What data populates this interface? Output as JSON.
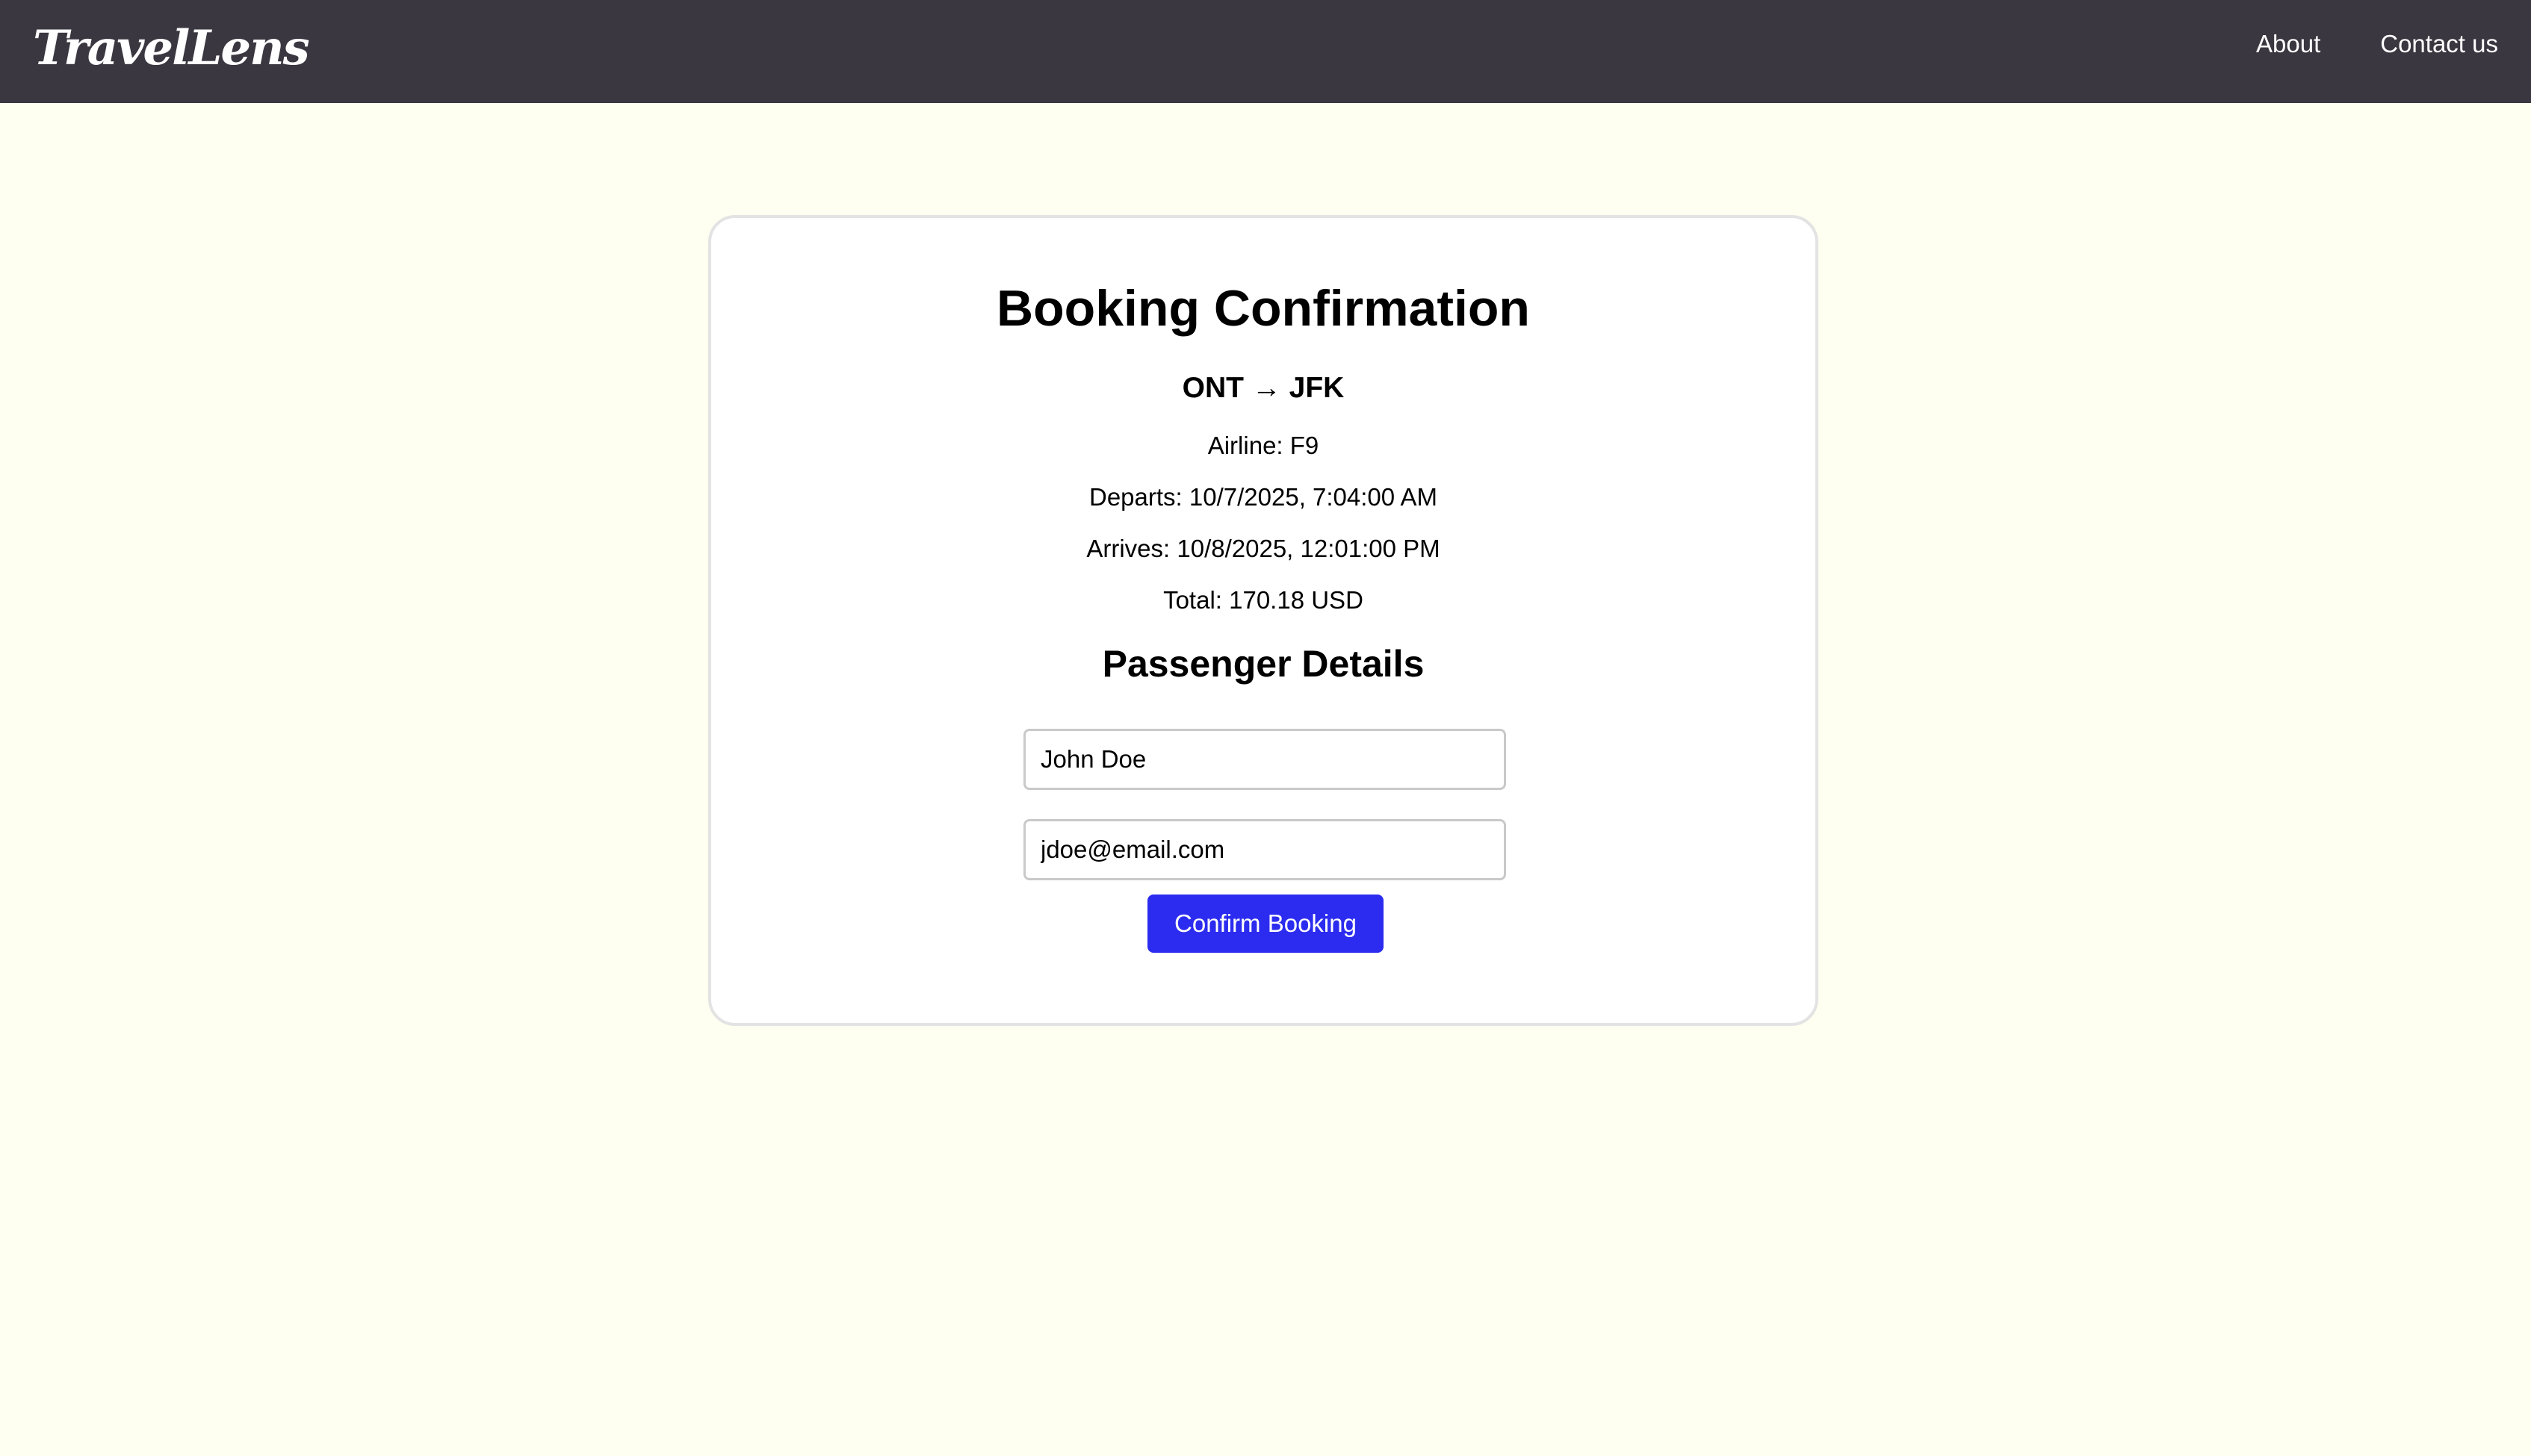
{
  "header": {
    "logo": "TravelLens",
    "nav": [
      {
        "label": "About"
      },
      {
        "label": "Contact us"
      }
    ],
    "background": "#3A3740"
  },
  "page": {
    "background": "#FEFFF0"
  },
  "booking": {
    "title": "Booking Confirmation",
    "route": "ONT → JFK",
    "airline": "Airline: F9",
    "departs": "Departs: 10/7/2025, 7:04:00 AM",
    "arrives": "Arrives: 10/8/2025, 12:01:00 PM",
    "total": "Total: 170.18 USD",
    "passenger_heading": "Passenger Details",
    "name_value": "John Doe",
    "email_value": "jdoe@email.com",
    "confirm_label": "Confirm Booking",
    "button_color": "#2C2CF0"
  }
}
